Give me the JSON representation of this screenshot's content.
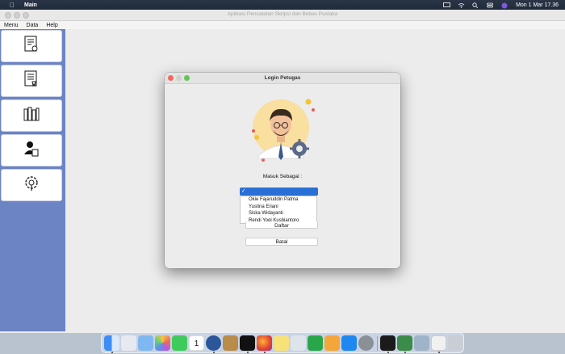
{
  "menubar": {
    "app_name": "Main",
    "clock": "Mon 1 Mar  17.36"
  },
  "window": {
    "title": "Aplikasi Pencatatan Skripsi dan Bebas Pustaka"
  },
  "menu": {
    "items": [
      "Menu",
      "Data",
      "Help"
    ]
  },
  "sidebar": {
    "items": [
      {
        "icon": "certificate-icon"
      },
      {
        "icon": "document-icon"
      },
      {
        "icon": "library-icon"
      },
      {
        "icon": "user-copy-icon"
      },
      {
        "icon": "settings-icon"
      }
    ]
  },
  "dialog": {
    "title": "Login Petugas",
    "masuk_label": "Masuk Sebagai :",
    "selected": "",
    "options": [
      "Okie Fajaruddin Patma",
      "Yustina Eriani",
      "Siska Widayanti",
      "Rendi Yogi Kusbiantoro"
    ],
    "login_button_partial": "Daftar",
    "cancel_button": "Batal",
    "colors": {
      "accent": "#2a6fd6",
      "close": "#ed6a5e",
      "min": "#f5bf4f",
      "max": "#61c554"
    }
  },
  "dock": {
    "apps": [
      "finder-icon",
      "launchpad-icon",
      "preview-icon",
      "photos-icon",
      "facetime-icon",
      "calendar-icon",
      "word-icon",
      "notes-icon",
      "intellij-icon",
      "firefox-icon",
      "stickies-icon",
      "utility-icon",
      "numbers-icon",
      "pages-icon",
      "appstore-icon",
      "system-preferences-icon",
      "terminal-icon",
      "netbeans-icon",
      "screenshot-icon",
      "java-icon",
      "trash-icon"
    ],
    "calendar_day": "1"
  }
}
